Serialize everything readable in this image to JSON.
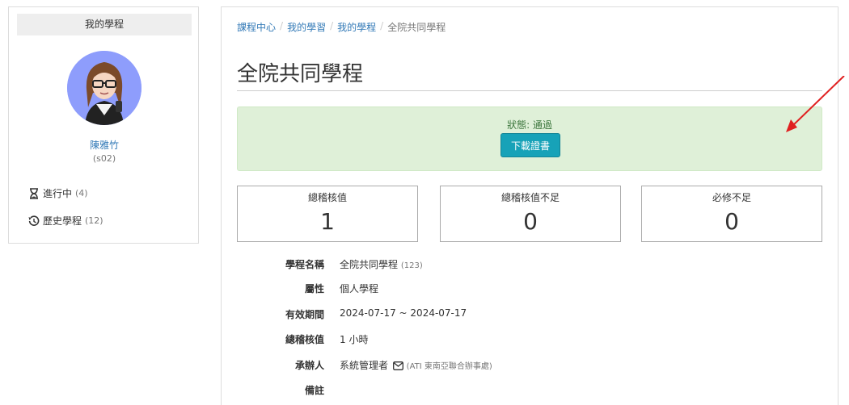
{
  "sidebar": {
    "title": "我的學程",
    "user_name": "陳雅竹",
    "user_id": "(s02)",
    "items": [
      {
        "label": "進行中",
        "count": "(4)"
      },
      {
        "label": "歷史學程",
        "count": "(12)"
      }
    ]
  },
  "breadcrumb": [
    {
      "label": "課程中心"
    },
    {
      "label": "我的學習"
    },
    {
      "label": "我的學程"
    },
    {
      "label": "全院共同學程"
    }
  ],
  "page_title": "全院共同學程",
  "status": {
    "text": "狀態: 通過",
    "button_label": "下載證書"
  },
  "stats": [
    {
      "label": "總稽核值",
      "value": "1"
    },
    {
      "label": "總稽核值不足",
      "value": "0"
    },
    {
      "label": "必修不足",
      "value": "0"
    }
  ],
  "info": {
    "name_label": "學程名稱",
    "name_value": "全院共同學程",
    "name_count": "(123)",
    "attr_label": "屬性",
    "attr_value": "個人學程",
    "period_label": "有效期間",
    "period_value": "2024-07-17 ~ 2024-07-17",
    "total_label": "總稽核值",
    "total_value": "1 小時",
    "organizer_label": "承辦人",
    "organizer_value": "系統管理者",
    "organizer_org": "(ATI 東南亞聯合辦事處)",
    "note_label": "備註"
  },
  "colors": {
    "link": "#337ab7",
    "success_bg": "#dff0d8",
    "button": "#17a2b8",
    "arrow": "#e02020"
  },
  "icons": [
    "hourglass-icon",
    "history-icon",
    "envelope-icon",
    "arrow-annotation"
  ]
}
